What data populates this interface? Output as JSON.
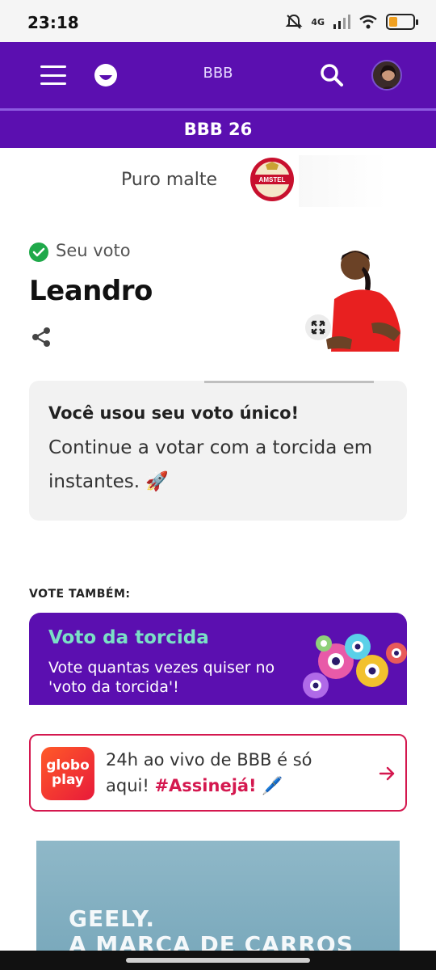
{
  "status": {
    "time": "23:18",
    "network": "4G",
    "battery_level": 0.35
  },
  "header": {
    "title": "BBB",
    "icons": [
      "menu-icon",
      "globo-smile-icon",
      "search-icon",
      "profile-avatar"
    ]
  },
  "subheader": {
    "title": "BBB 26"
  },
  "sponsor": {
    "text": "Puro malte",
    "logo_name": "amstel-logo"
  },
  "vote": {
    "status_label": "Seu voto",
    "name": "Leandro",
    "share_icon": "share-icon",
    "expand_icon": "expand-icon"
  },
  "info_card": {
    "title": "Você usou seu voto único!",
    "body": "Continue a votar com a torcida em instantes.",
    "emoji": "🚀"
  },
  "vote_also": {
    "label": "VOTE TAMBÉM:"
  },
  "torcida_card": {
    "title": "Voto da torcida",
    "subtitle": "Vote quantas vezes quiser no 'voto da torcida'!",
    "accent_color": "#7be0c6",
    "bg_color": "#5b0fb0"
  },
  "globo_card": {
    "logo_line1": "globo",
    "logo_line2": "play",
    "text": "24h ao vivo de BBB é só aqui!",
    "hashtag": "#Assinejá!",
    "emoji": "🖊️",
    "accent_color": "#d4184f"
  },
  "ad": {
    "line1": "GEELY.",
    "line2": "A MARCA DE CARROS"
  },
  "colors": {
    "brand_purple": "#5b0fb0",
    "check_green": "#1fa94a"
  }
}
